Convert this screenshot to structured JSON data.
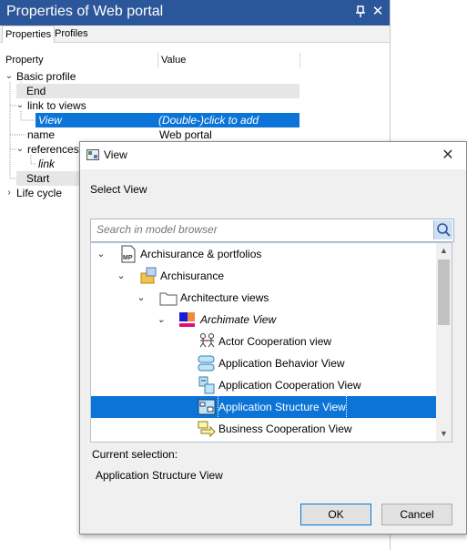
{
  "panel": {
    "title": "Properties of Web portal",
    "tabs": [
      "Properties",
      "Profiles"
    ],
    "columns": [
      "Property",
      "Value"
    ],
    "rows": [
      {
        "label": "Basic profile",
        "value": ""
      },
      {
        "label": "End",
        "value": ""
      },
      {
        "label": "link to views",
        "value": ""
      },
      {
        "label": "View",
        "value": "(Double-)click to add"
      },
      {
        "label": "name",
        "value": "Web portal"
      },
      {
        "label": "references",
        "value": ""
      },
      {
        "label": "link",
        "value": ""
      },
      {
        "label": "Start",
        "value": ""
      },
      {
        "label": "Life cycle",
        "value": ""
      }
    ]
  },
  "dialog": {
    "title": "View",
    "prompt": "Select View",
    "search_placeholder": "Search in model browser",
    "tree": [
      {
        "label": "Archisurance & portfolios",
        "icon": "model-package-icon"
      },
      {
        "label": "Archisurance",
        "icon": "package-icon"
      },
      {
        "label": "Architecture views",
        "icon": "folder-icon"
      },
      {
        "label": "Archimate View",
        "icon": "archimate-view-icon"
      },
      {
        "label": "Actor Cooperation view",
        "icon": "actor-cooperation-icon"
      },
      {
        "label": "Application Behavior View",
        "icon": "application-behavior-icon"
      },
      {
        "label": "Application Cooperation View",
        "icon": "application-cooperation-icon"
      },
      {
        "label": "Application Structure View",
        "icon": "application-structure-icon"
      },
      {
        "label": "Business Cooperation View",
        "icon": "business-cooperation-icon"
      }
    ],
    "selected_item": "Application Structure View",
    "current_selection_label": "Current selection:",
    "current_selection_value": "Application Structure View",
    "ok_label": "OK",
    "cancel_label": "Cancel"
  },
  "colors": {
    "title_bar": "#2b579a",
    "selection": "#0b74d6"
  }
}
